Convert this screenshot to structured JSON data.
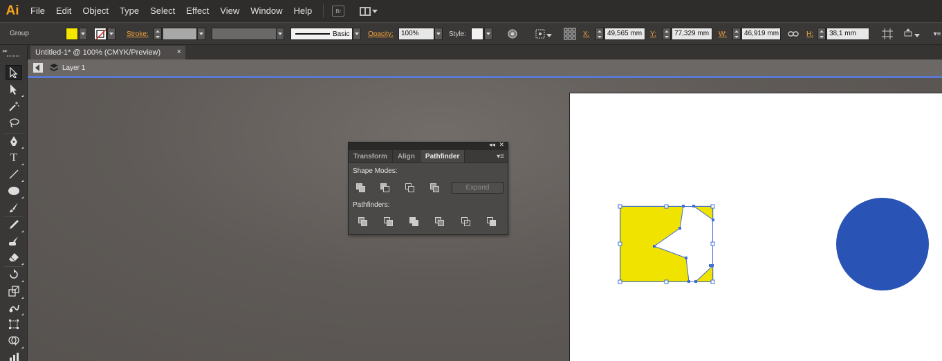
{
  "app": {
    "logo": "Ai"
  },
  "menu": [
    "File",
    "Edit",
    "Object",
    "Type",
    "Select",
    "Effect",
    "View",
    "Window",
    "Help"
  ],
  "bridge_label": "Br",
  "control": {
    "selection_type": "Group",
    "fill_color": "#f5e600",
    "stroke_label": "Stroke:",
    "stroke_style": "Basic",
    "opacity_label": "Opacity:",
    "opacity_value": "100%",
    "style_label": "Style:",
    "x_label": "X:",
    "x_value": "49,565 mm",
    "y_label": "Y:",
    "y_value": "77,329 mm",
    "w_label": "W:",
    "w_value": "46,919 mm",
    "h_label": "H:",
    "h_value": "38,1 mm"
  },
  "tab": {
    "title": "Untitled-1* @ 100% (CMYK/Preview)",
    "close": "×"
  },
  "breadcrumb": {
    "layer": "Layer 1"
  },
  "tools": [
    "selection-tool",
    "direct-selection-tool",
    "magic-wand-tool",
    "lasso-tool",
    "pen-tool",
    "type-tool",
    "line-segment-tool",
    "ellipse-tool",
    "paintbrush-tool",
    "pencil-tool",
    "blob-brush-tool",
    "eraser-tool",
    "rotate-tool",
    "scale-tool",
    "warp-tool",
    "free-transform-tool",
    "shape-builder-tool",
    "graph-tool"
  ],
  "pathfinder": {
    "tabs": [
      "Transform",
      "Align",
      "Pathfinder"
    ],
    "active_tab": "Pathfinder",
    "shape_modes_label": "Shape Modes:",
    "pathfinders_label": "Pathfinders:",
    "expand_label": "Expand"
  },
  "colors": {
    "artwork_yellow": "#f1e300",
    "artwork_blue": "#2953b4",
    "selection_blue": "#3f6fd6",
    "accent_orange": "#f0a23c"
  }
}
